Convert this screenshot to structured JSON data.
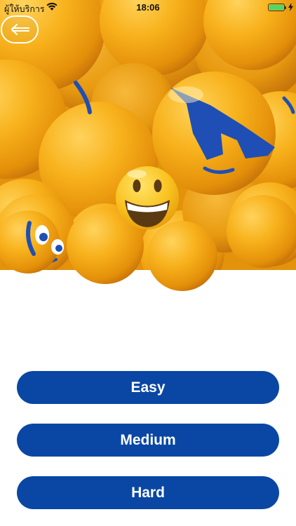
{
  "status_bar": {
    "carrier": "ผู้ให้บริการ",
    "time": "18:06"
  },
  "navigation": {
    "back_icon": "arrow-left-icon"
  },
  "hero": {
    "image": "emoji-balloons",
    "emoji": "grinning-face"
  },
  "difficulty_buttons": [
    {
      "label": "Easy"
    },
    {
      "label": "Medium"
    },
    {
      "label": "Hard"
    }
  ],
  "colors": {
    "button_bg": "#0a47a4",
    "button_text": "#ffffff",
    "balloon": "#f5a60f",
    "face_blue": "#1f4fb5",
    "battery": "#4cd964"
  }
}
